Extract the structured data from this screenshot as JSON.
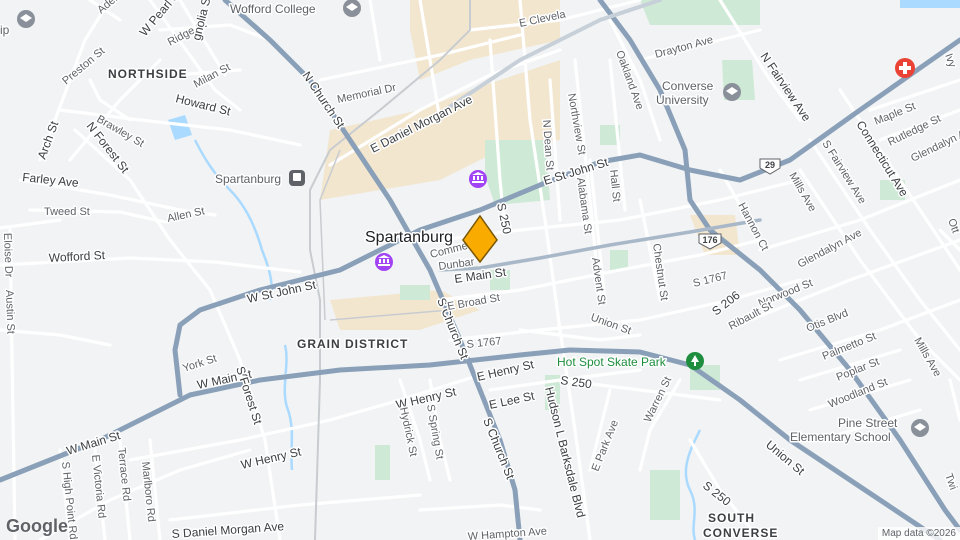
{
  "map": {
    "attribution": "Map data ©2026",
    "logo": "Google",
    "marker": {
      "icon": "location-pin-icon",
      "color": "#f9ab00"
    }
  },
  "labels": {
    "city": "Spartanburg",
    "northside": "NORTHSIDE",
    "grain_district": "GRAIN DISTRICT",
    "south_converse": "SOUTH\nCONVERSE",
    "south_converse_1": "SOUTH",
    "south_converse_2": "CONVERSE",
    "streets": {
      "w_main_st": "W Main St",
      "w_main_st_2": "W Main St",
      "e_main_st": "E Main St",
      "w_st_john_st": "W St John St",
      "e_st_john_st": "E St John St",
      "n_church_st": "N Church St",
      "s_church_st": "S Church St",
      "s_church_st_2": "S Church St",
      "e_daniel_morgan_ave": "E Daniel Morgan Ave",
      "s_daniel_morgan_ave": "S Daniel Morgan Ave",
      "memorial_dr": "Memorial Dr",
      "howard_st": "Howard St",
      "farley_ave": "Farley Ave",
      "tweed_st": "Tweed St",
      "allen_st": "Allen St",
      "wofford_st": "Wofford St",
      "eloise_dr": "Eloise Dr",
      "austin_st": "Austin St",
      "arch_st": "Arch St",
      "n_forest_st": "N Forest St",
      "s_forest_st": "S Forest St",
      "brawley_st": "Brawley St",
      "preston_st": "Preston St",
      "ridge_st": "Ridge St",
      "milan_st": "Milan St",
      "magnolia_st": "gnolia St",
      "w_pearl_st": "W Pearl S",
      "adel_st": "Aden",
      "york_st": "York St",
      "w_henry_st": "W Henry St",
      "w_henry_st_2": "W Henry St",
      "e_henry_st": "E Henry St",
      "hydrick_st": "Hydrick St",
      "s_spring_st": "S Spring St",
      "e_lee_st": "E Lee St",
      "w_hampton_ave": "W Hampton Ave",
      "hudson_l_barksdale_blvd": "Hudson L Barksdale Blvd",
      "commerce_st": "Commerce",
      "dunbar_st": "Dunbar",
      "e_broad_st": "E Broad St",
      "s1767_a": "S 1767",
      "s1767_b": "S 1767",
      "s250_a": "S 250",
      "s250_b": "S 250",
      "s250_c": "S 250",
      "s206": "S 206",
      "n_dean_st": "N Dean St",
      "northview_st": "Northview St",
      "alabama_st": "Alabama St",
      "hall_st": "Hall St",
      "chestnut_st": "Chestnut St",
      "advent_st": "Advent St",
      "union_st": "Union St",
      "union_st_2": "Union St",
      "e_park_ave": "E Park Ave",
      "warren_st": "Warren St",
      "oakland_ave": "Oakland Ave",
      "drayton_ave": "Drayton Ave",
      "e_cleveland": "E Clevela",
      "n_fairview_ave": "N Fairview Ave",
      "s_fairview_ave": "S Fairview Ave",
      "connecticut_ave": "Connecticut Ave",
      "hannon_ct": "Hannon Ct",
      "mills_ave": "Mills Ave",
      "mills_ave_2": "Mills Ave",
      "maple_st": "Maple St",
      "rutledge_st": "Rutledge St",
      "glendalyn_ave": "Glendalyn Ave",
      "glendalyn_ave_2": "Glendalyn Ave",
      "norwood_st": "Norwood St",
      "ribault_st": "Ribault St",
      "otis_blvd": "Otis Blvd",
      "palmetto_st": "Palmetto St",
      "poplar_st": "Poplar St",
      "woodland_st": "Woodland St",
      "s_high_point_rd": "S High Point Rd",
      "e_victoria_rd": "E Victoria Rd",
      "terrace_rd": "Terrace Rd",
      "marlboro_rd": "Marlboro Rd",
      "ivy": "Ivy",
      "twi": "Twi",
      "ott": "Ott"
    },
    "shields": {
      "us29": "29",
      "us176": "176"
    }
  },
  "pois": {
    "wofford_college": "Wofford College",
    "converse_university": "Converse University",
    "spartanburg_station": "Spartanburg",
    "hot_spot_skate_park": "Hot Spot Skate Park",
    "pine_street_elementary": "Pine Street Elementary School",
    "pine_street_line1": "Pine Street",
    "pine_street_line2": "Elementary School",
    "top_left_partial": "ip"
  },
  "colors": {
    "background": "#f1f3f4",
    "road_major": "#8aa0b8",
    "road_minor": "#ffffff",
    "park": "#ceead6",
    "water": "#aadaff",
    "campus": "#f2e6cf",
    "poi_gray": "#5f6368",
    "poi_green": "#1e8e3e",
    "hospital": "#ea4335"
  }
}
